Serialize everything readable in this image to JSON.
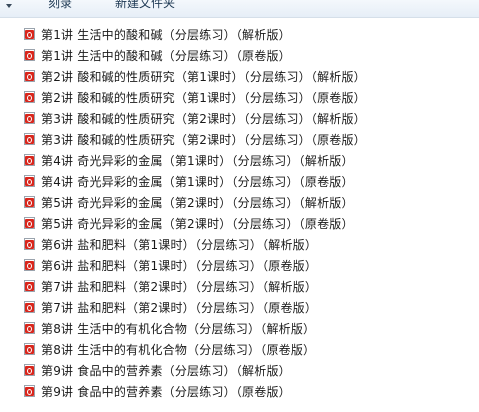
{
  "toolbar": {
    "items": [
      {
        "label": "刻录"
      },
      {
        "label": "新建文件夹"
      }
    ]
  },
  "files": [
    {
      "name": "第1讲  生活中的酸和碱（分层练习）（解析版）",
      "icon": "pdf-file-icon"
    },
    {
      "name": "第1讲  生活中的酸和碱（分层练习）（原卷版）",
      "icon": "pdf-file-icon"
    },
    {
      "name": "第2讲  酸和碱的性质研究（第1课时）（分层练习）（解析版）",
      "icon": "pdf-file-icon"
    },
    {
      "name": "第2讲  酸和碱的性质研究（第1课时）（分层练习）（原卷版）",
      "icon": "pdf-file-icon"
    },
    {
      "name": "第3讲  酸和碱的性质研究（第2课时）（分层练习）（解析版）",
      "icon": "pdf-file-icon"
    },
    {
      "name": "第3讲  酸和碱的性质研究（第2课时）（分层练习）（原卷版）",
      "icon": "pdf-file-icon"
    },
    {
      "name": "第4讲  奇光异彩的金属（第1课时）（分层练习）（解析版）",
      "icon": "pdf-file-icon"
    },
    {
      "name": "第4讲  奇光异彩的金属（第1课时）（分层练习）（原卷版）",
      "icon": "pdf-file-icon"
    },
    {
      "name": "第5讲  奇光异彩的金属（第2课时）（分层练习）（解析版）",
      "icon": "pdf-file-icon"
    },
    {
      "name": "第5讲  奇光异彩的金属（第2课时）（分层练习）（原卷版）",
      "icon": "pdf-file-icon"
    },
    {
      "name": "第6讲  盐和肥料（第1课时）（分层练习）（解析版）",
      "icon": "pdf-file-icon"
    },
    {
      "name": "第6讲  盐和肥料（第1课时）（分层练习）（原卷版）",
      "icon": "pdf-file-icon"
    },
    {
      "name": "第7讲  盐和肥料（第2课时）（分层练习）（解析版）",
      "icon": "pdf-file-icon"
    },
    {
      "name": "第7讲  盐和肥料（第2课时）（分层练习）（原卷版）",
      "icon": "pdf-file-icon"
    },
    {
      "name": "第8讲  生活中的有机化合物（分层练习）（解析版）",
      "icon": "pdf-file-icon"
    },
    {
      "name": "第8讲  生活中的有机化合物（分层练习）（原卷版）",
      "icon": "pdf-file-icon"
    },
    {
      "name": "第9讲  食品中的营养素（分层练习）（解析版）",
      "icon": "pdf-file-icon"
    },
    {
      "name": "第9讲  食品中的营养素（分层练习）（原卷版）",
      "icon": "pdf-file-icon"
    }
  ]
}
